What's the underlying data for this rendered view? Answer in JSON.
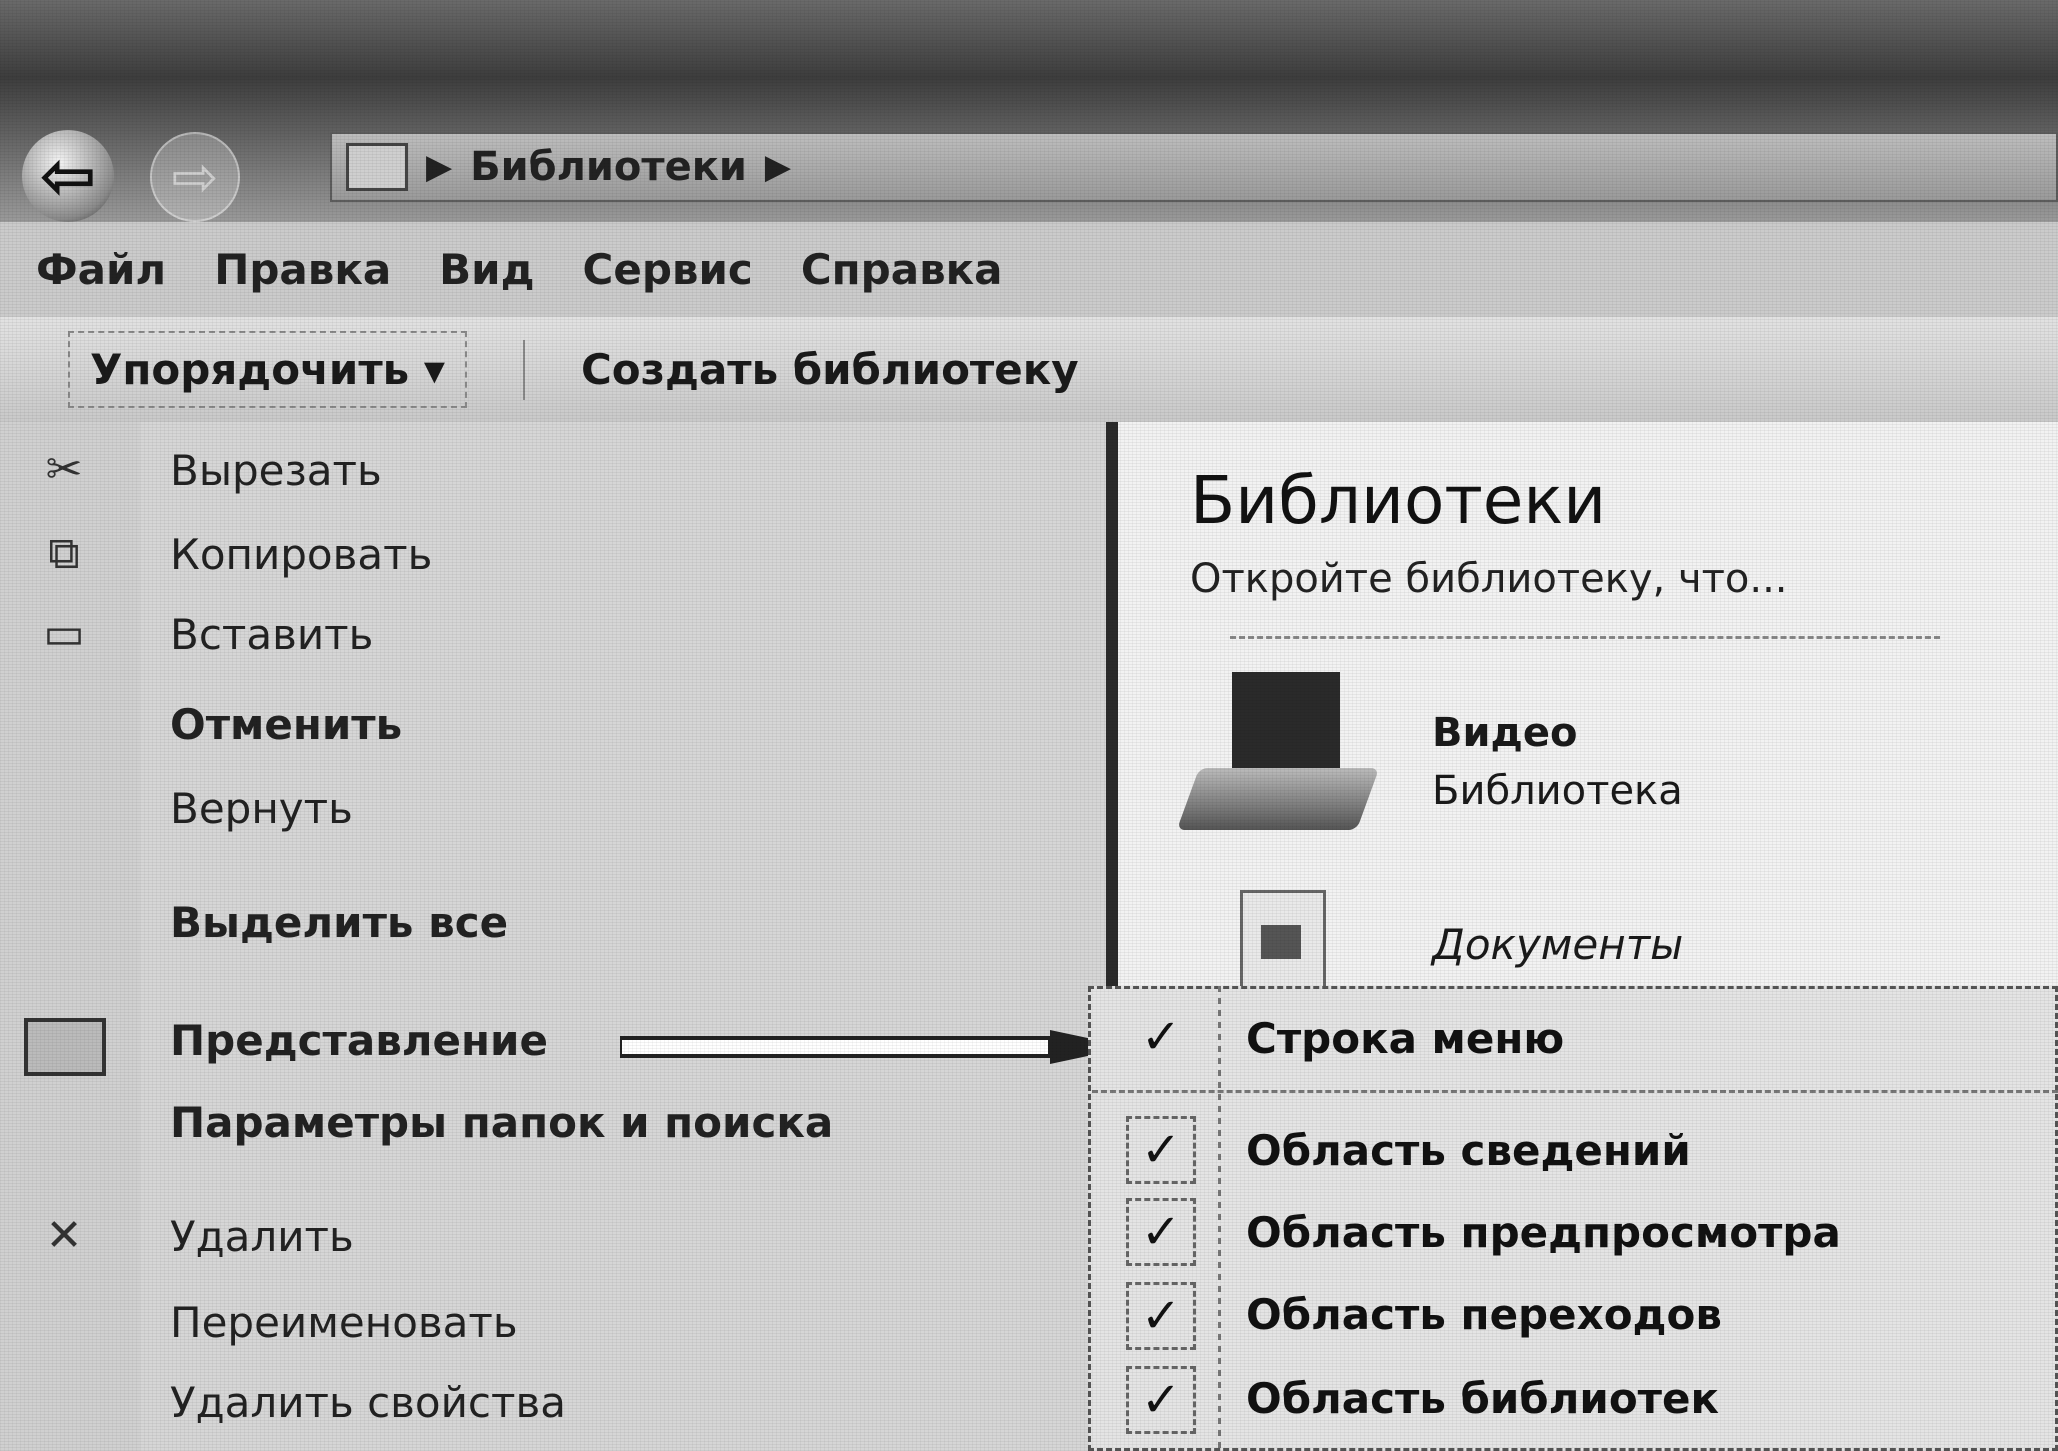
{
  "address_bar": {
    "breadcrumb": "Библиотеки",
    "separator": "▶"
  },
  "menubar": {
    "items": [
      "Файл",
      "Правка",
      "Вид",
      "Сервис",
      "Справка"
    ]
  },
  "toolbar": {
    "organize_label": "Упорядочить ▾",
    "create_library_label": "Создать библиотеку"
  },
  "context_menu": {
    "cut": "Вырезать",
    "copy": "Копировать",
    "paste": "Вставить",
    "undo": "Отменить",
    "redo": "Вернуть",
    "select_all": "Выделить все",
    "view": "Представление",
    "folder_options": "Параметры папок и поиска",
    "delete": "Удалить",
    "rename": "Переименовать",
    "remove_properties": "Удалить свойства"
  },
  "submenu": {
    "items": [
      {
        "label": "Строка меню",
        "checked": "✓"
      },
      {
        "label": "Область сведений",
        "checked": "✓"
      },
      {
        "label": "Область предпросмотра",
        "checked": "✓"
      },
      {
        "label": "Область переходов",
        "checked": "✓"
      },
      {
        "label": "Область библиотек",
        "checked": "✓"
      }
    ]
  },
  "content": {
    "title": "Библиотеки",
    "subtitle": "Откройте библиотеку, что...",
    "libraries": [
      {
        "name": "Видео",
        "type": "Библиотека",
        "icon": "video-library-icon"
      },
      {
        "name": "Документы",
        "icon": "documents-library-icon"
      }
    ]
  },
  "colors": {
    "background": "#d9d9d9",
    "titlebar": "#3d3d3d",
    "menu_border": "#2b2b2b"
  }
}
